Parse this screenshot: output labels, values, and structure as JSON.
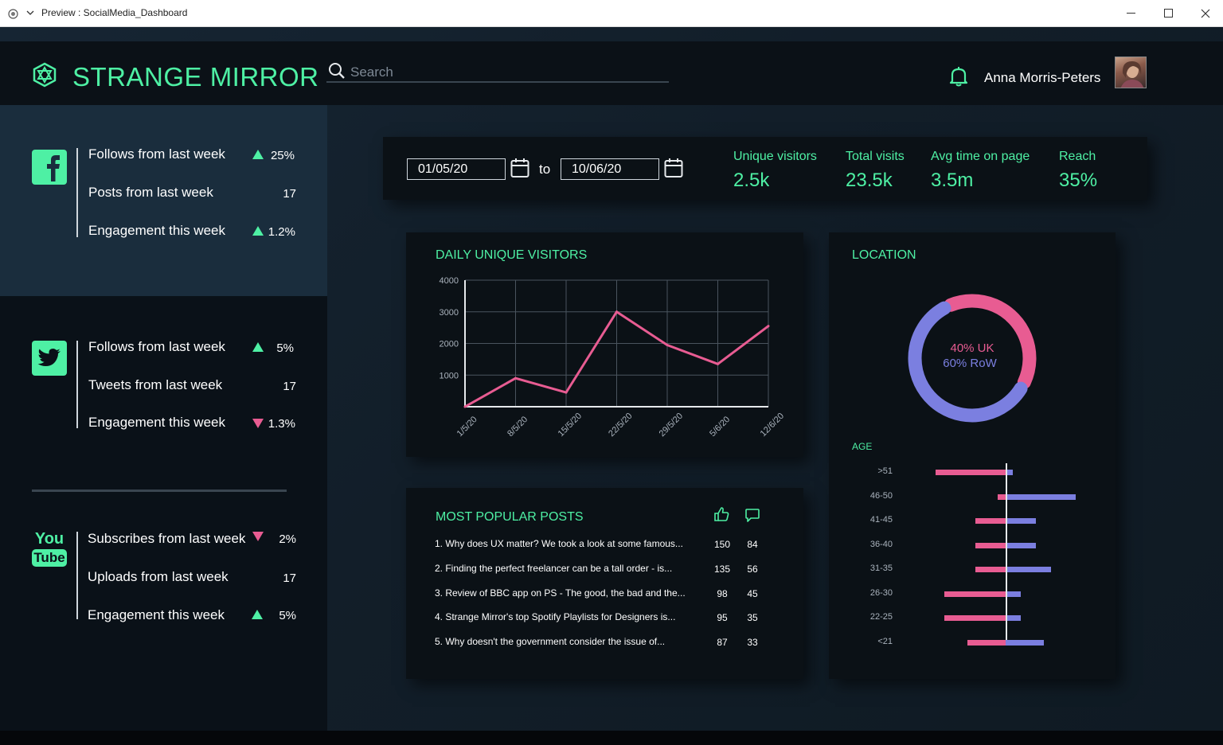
{
  "window": {
    "title": "Preview : SocialMedia_Dashboard"
  },
  "header": {
    "brand": "STRANGE MIRROR",
    "search_placeholder": "Search",
    "user_name": "Anna Morris-Peters"
  },
  "colors": {
    "accent_green": "#4ef0a4",
    "accent_pink": "#e85c92",
    "accent_blue": "#7b7fe0"
  },
  "sidebar": {
    "facebook": {
      "icon": "facebook-icon",
      "stats": [
        {
          "label": "Follows from last week",
          "trend": "up",
          "value": "25%"
        },
        {
          "label": "Posts from last week",
          "trend": "none",
          "value": "17"
        },
        {
          "label": "Engagement this week",
          "trend": "up",
          "value": "1.2%"
        }
      ]
    },
    "twitter": {
      "icon": "twitter-icon",
      "stats": [
        {
          "label": "Follows from last week",
          "trend": "up",
          "value": "5%"
        },
        {
          "label": "Tweets from last week",
          "trend": "none",
          "value": "17"
        },
        {
          "label": "Engagement this week",
          "trend": "down",
          "value": "1.3%"
        }
      ]
    },
    "youtube": {
      "icon": "youtube-icon",
      "logo_top": "You",
      "logo_bottom": "Tube",
      "stats": [
        {
          "label": "Subscribes from last week",
          "trend": "down",
          "value": "2%"
        },
        {
          "label": "Uploads from last week",
          "trend": "none",
          "value": "17"
        },
        {
          "label": "Engagement this week",
          "trend": "up",
          "value": "5%"
        }
      ]
    }
  },
  "filters": {
    "date_from": "01/05/20",
    "to_label": "to",
    "date_to": "10/06/20"
  },
  "kpis": [
    {
      "label": "Unique visitors",
      "value": "2.5k"
    },
    {
      "label": "Total visits",
      "value": "23.5k"
    },
    {
      "label": "Avg time on page",
      "value": "3.5m"
    },
    {
      "label": "Reach",
      "value": "35%"
    }
  ],
  "chart_data": {
    "type": "line",
    "title": "DAILY UNIQUE VISITORS",
    "x": [
      "1/5/20",
      "8/5/20",
      "15/5/20",
      "22/5/20",
      "29/5/20",
      "5/6/20",
      "12/6/20"
    ],
    "series": [
      {
        "values": [
          0,
          900,
          450,
          3000,
          1950,
          1350,
          2550
        ]
      }
    ],
    "yticks": [
      1000,
      2000,
      3000,
      4000
    ],
    "ylim": [
      0,
      4000
    ],
    "grid": true
  },
  "posts": {
    "title": "MOST POPULAR POSTS",
    "likes_icon": "thumbs-up-icon",
    "comments_icon": "comment-icon",
    "rows": [
      {
        "text": "1. Why does UX matter? We took a look at some famous...",
        "likes": "150",
        "comments": "84"
      },
      {
        "text": "2. Finding the perfect freelancer can be a tall order - is...",
        "likes": "135",
        "comments": "56"
      },
      {
        "text": "3. Review of BBC app on PS - The good, the bad and the...",
        "likes": "98",
        "comments": "45"
      },
      {
        "text": "4. Strange Mirror's top Spotify Playlists for Designers is...",
        "likes": "95",
        "comments": "35"
      },
      {
        "text": "5. Why doesn't the government consider the issue of...",
        "likes": "87",
        "comments": "33"
      }
    ]
  },
  "location": {
    "title": "LOCATION",
    "donut": {
      "uk_percent": 40,
      "row_percent": 60,
      "uk_label": "40% UK",
      "row_label": "60% RoW"
    },
    "age_title": "AGE",
    "age_groups": [
      {
        "label": ">51",
        "pink": 88,
        "blue": 9
      },
      {
        "label": "46-50",
        "pink": 10,
        "blue": 88
      },
      {
        "label": "41-45",
        "pink": 38,
        "blue": 38
      },
      {
        "label": "36-40",
        "pink": 38,
        "blue": 38
      },
      {
        "label": "31-35",
        "pink": 38,
        "blue": 57
      },
      {
        "label": "26-30",
        "pink": 77,
        "blue": 19
      },
      {
        "label": "22-25",
        "pink": 77,
        "blue": 19
      },
      {
        "label": "<21",
        "pink": 48,
        "blue": 48
      }
    ]
  }
}
